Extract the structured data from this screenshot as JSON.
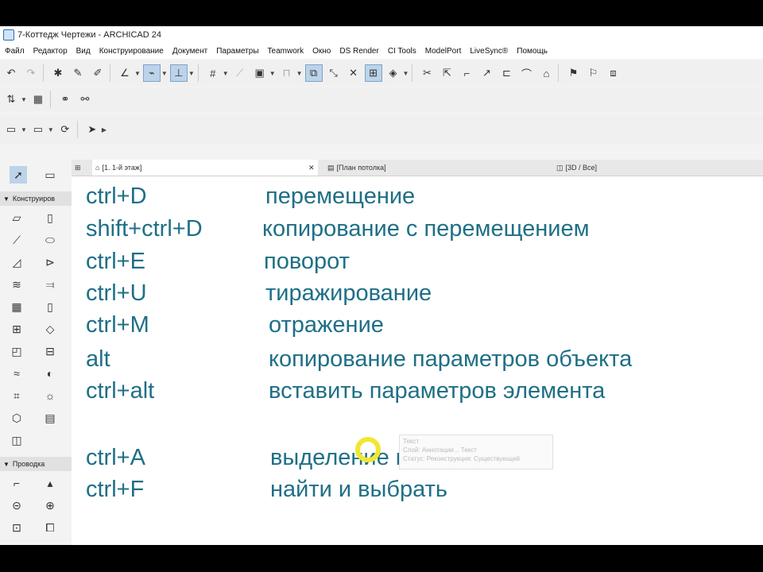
{
  "window": {
    "title": "7-Коттедж Чертежи - ARCHICAD 24"
  },
  "menu": [
    "Файл",
    "Редактор",
    "Вид",
    "Конструирование",
    "Документ",
    "Параметры",
    "Teamwork",
    "Окно",
    "DS Render",
    "CI Tools",
    "ModelPort",
    "LiveSync®",
    "Помощь"
  ],
  "toolbox": {
    "section_design": "Конструиров",
    "section_wiring": "Проводка"
  },
  "tabs": [
    {
      "label": "[1. 1-й этаж]",
      "icon": "floor-plan-icon"
    },
    {
      "label": "[План потолка]",
      "icon": "ceiling-plan-icon"
    },
    {
      "label": "[3D / Все]",
      "icon": "3d-view-icon"
    }
  ],
  "shortcuts": [
    {
      "keys": "ctrl+D",
      "action": "перемещение"
    },
    {
      "keys": "shift+ctrl+D",
      "action": "копирование с перемещением"
    },
    {
      "keys": "ctrl+E",
      "action": "поворот"
    },
    {
      "keys": "ctrl+U",
      "action": "тиражирование"
    },
    {
      "keys": "ctrl+M",
      "action": "отражение"
    },
    {
      "keys": "alt",
      "action": "копирование параметров объекта"
    },
    {
      "keys": "ctrl+alt",
      "action": "вставить параметров элемента"
    },
    {
      "keys": "ctrl+A",
      "action": "выделение всего"
    },
    {
      "keys": "ctrl+F",
      "action": "найти и выбрать"
    }
  ],
  "tooltip": {
    "line1": "Текст",
    "line2": "Слой: Аннотации... Текст",
    "line3": "Статус: Реконструкция: Существующий"
  },
  "colors": {
    "text_accent": "#1f6f86",
    "cursor_highlight": "#f3e531",
    "active_tool": "#bcd3ea"
  }
}
